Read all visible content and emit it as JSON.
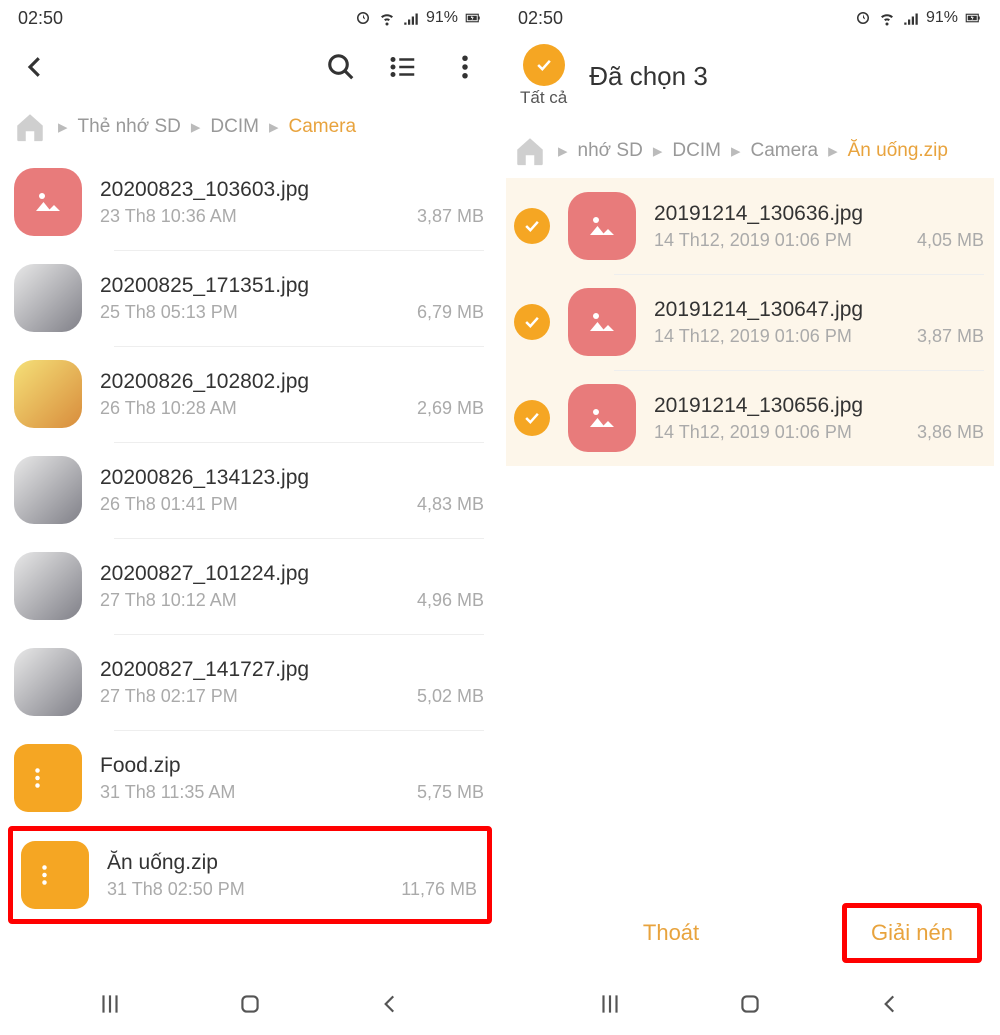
{
  "left": {
    "status": {
      "time": "02:50",
      "battery": "91%"
    },
    "breadcrumb": [
      "Thẻ nhớ SD",
      "DCIM",
      "Camera"
    ],
    "files": [
      {
        "name": "20200823_103603.jpg",
        "date": "23 Th8 10:36 AM",
        "size": "3,87 MB",
        "thumb": "pink"
      },
      {
        "name": "20200825_171351.jpg",
        "date": "25 Th8 05:13 PM",
        "size": "6,79 MB",
        "thumb": "doc"
      },
      {
        "name": "20200826_102802.jpg",
        "date": "26 Th8 10:28 AM",
        "size": "2,69 MB",
        "thumb": "food"
      },
      {
        "name": "20200826_134123.jpg",
        "date": "26 Th8 01:41 PM",
        "size": "4,83 MB",
        "thumb": "doc"
      },
      {
        "name": "20200827_101224.jpg",
        "date": "27 Th8 10:12 AM",
        "size": "4,96 MB",
        "thumb": "doc"
      },
      {
        "name": "20200827_141727.jpg",
        "date": "27 Th8 02:17 PM",
        "size": "5,02 MB",
        "thumb": "doc"
      },
      {
        "name": "Food.zip",
        "date": "31 Th8 11:35 AM",
        "size": "5,75 MB",
        "thumb": "zip"
      },
      {
        "name": "Ăn uống.zip",
        "date": "31 Th8 02:50 PM",
        "size": "11,76 MB",
        "thumb": "zip",
        "highlight": true
      }
    ]
  },
  "right": {
    "status": {
      "time": "02:50",
      "battery": "91%"
    },
    "select_all_label": "Tất cả",
    "selection_title": "Đã chọn 3",
    "breadcrumb": [
      "nhớ SD",
      "DCIM",
      "Camera",
      "Ăn uống.zip"
    ],
    "files": [
      {
        "name": "20191214_130636.jpg",
        "date": "14 Th12, 2019 01:06 PM",
        "size": "4,05 MB"
      },
      {
        "name": "20191214_130647.jpg",
        "date": "14 Th12, 2019 01:06 PM",
        "size": "3,87 MB"
      },
      {
        "name": "20191214_130656.jpg",
        "date": "14 Th12, 2019 01:06 PM",
        "size": "3,86 MB"
      }
    ],
    "actions": {
      "exit": "Thoát",
      "extract": "Giải nén"
    }
  }
}
